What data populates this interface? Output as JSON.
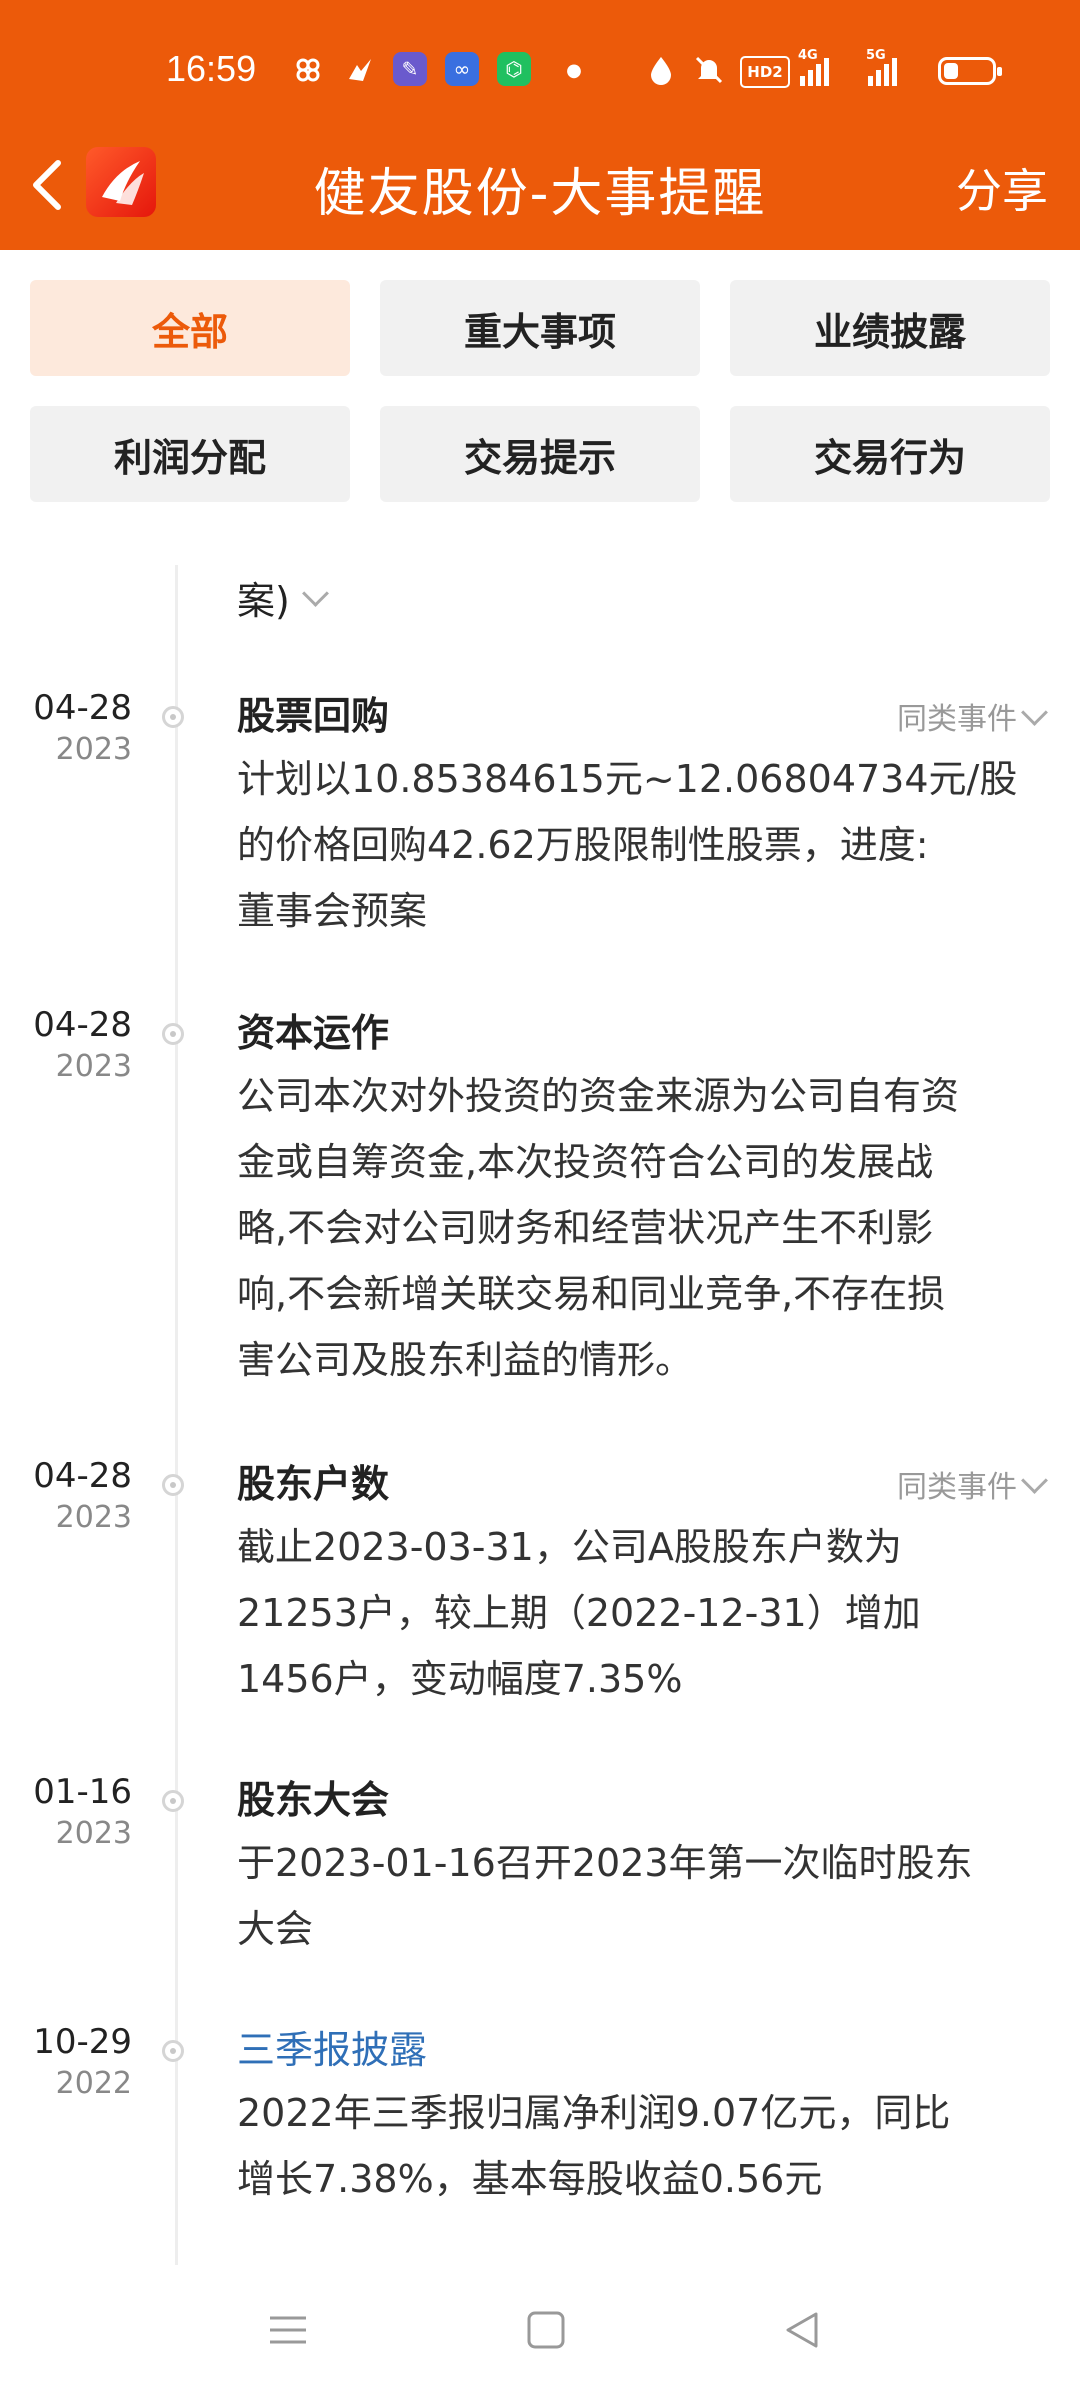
{
  "status": {
    "time": "16:59",
    "hd_label": "HD2",
    "net1": "4G",
    "net2": "5G",
    "battery_level": 0.3
  },
  "header": {
    "title": "健友股份-大事提醒",
    "share": "分享",
    "accent_color": "#ec5a0a"
  },
  "filters": [
    {
      "label": "全部",
      "active": true
    },
    {
      "label": "重大事项",
      "active": false
    },
    {
      "label": "业绩披露",
      "active": false
    },
    {
      "label": "利润分配",
      "active": false
    },
    {
      "label": "交易提示",
      "active": false
    },
    {
      "label": "交易行为",
      "active": false
    }
  ],
  "timeline": {
    "partial_text": "案)",
    "events": [
      {
        "md": "04-28",
        "year": "2023",
        "title": "股票回购",
        "similar": "同类事件",
        "body": [
          "计划以10.85384615元~12.06804734元/股",
          "的价格回购42.62万股限制性股票，进度:",
          "董事会预案"
        ]
      },
      {
        "md": "04-28",
        "year": "2023",
        "title": "资本运作",
        "similar": "",
        "body": [
          "公司本次对外投资的资金来源为公司自有资",
          "金或自筹资金,本次投资符合公司的发展战",
          "略,不会对公司财务和经营状况产生不利影",
          "响,不会新增关联交易和同业竞争,不存在损",
          "害公司及股东利益的情形。"
        ]
      },
      {
        "md": "04-28",
        "year": "2023",
        "title": "股东户数",
        "similar": "同类事件",
        "body": [
          "截止2023-03-31，公司A股股东户数为",
          "21253户，较上期（2022-12-31）增加",
          "1456户，变动幅度7.35%"
        ]
      },
      {
        "md": "01-16",
        "year": "2023",
        "title": "股东大会",
        "similar": "",
        "body": [
          "于2023-01-16召开2023年第一次临时股东",
          "大会"
        ]
      },
      {
        "md": "10-29",
        "year": "2022",
        "title": "三季报披露",
        "similar": "",
        "link": true,
        "body": [
          "2022年三季报归属净利润9.07亿元，同比",
          "增长7.38%，基本每股收益0.56元"
        ]
      }
    ]
  }
}
